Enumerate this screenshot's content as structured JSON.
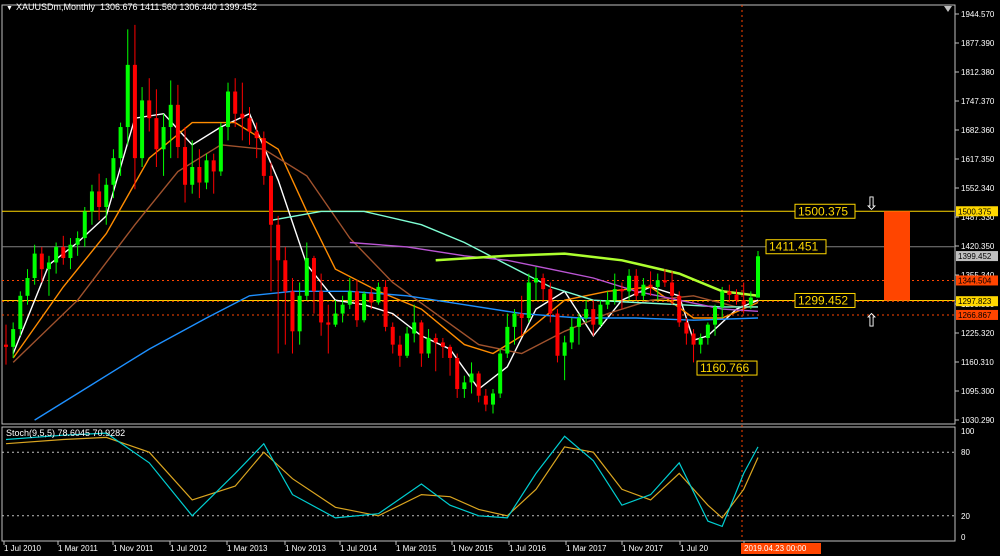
{
  "header": {
    "symbol": "XAUUSDm,Monthly",
    "ohlc": "1306.676 1411.560 1306.440 1399.452"
  },
  "stochastic": {
    "label": "Stoch(9,5,5) 78.6045 70.9282",
    "levels": [
      80,
      20
    ],
    "scale_labels": [
      "100",
      "80",
      "20",
      "0"
    ]
  },
  "colors": {
    "background": "#000000",
    "bull": "#00ff00",
    "bear": "#ff0000",
    "hline": "#ffd700",
    "box": "#ff4500",
    "ma_white": "#ffffff",
    "ma_orange": "#ff8c00",
    "ma_sienna": "#a0522d",
    "ma_aqua": "#7fffd4",
    "ma_violet": "#ba55d3",
    "ma_blue": "#1e90ff",
    "ma_yellowgreen": "#adff2f",
    "stoch_main": "#00ced1",
    "stoch_signal": "#daa520"
  },
  "chart_data": {
    "type": "candlestick",
    "title": "XAUUSDm,Monthly",
    "price_axis_labels": [
      "1944.570",
      "1877.390",
      "1812.380",
      "1747.370",
      "1682.360",
      "1617.350",
      "1552.340",
      "1487.330",
      "1420.350",
      "1355.340",
      "1290.330",
      "1225.320",
      "1160.310",
      "1095.300",
      "1030.290"
    ],
    "ylim": [
      1030.29,
      1944.57
    ],
    "time_axis_labels": [
      "1 Jul 2010",
      "1 Mar 2011",
      "1 Nov 2011",
      "1 Jul 2012",
      "1 Mar 2013",
      "1 Nov 2013",
      "1 Jul 2014",
      "1 Mar 2015",
      "1 Nov 2015",
      "1 Jul 2016",
      "1 Mar 2017",
      "1 Nov 2017",
      "1 Jul 20",
      "2019.04.23 00:00"
    ],
    "horizontal_lines": [
      {
        "label": "1500.375",
        "price": 1500.375,
        "style": "solid"
      },
      {
        "label": "1411.451",
        "price": 1420.35,
        "style": "solid-gray"
      },
      {
        "label": "1299.452",
        "price": 1299.452,
        "style": "solid"
      },
      {
        "label": "1344.504",
        "price": 1344.504,
        "style": "dotted"
      },
      {
        "label": "1297.823",
        "price": 1297.823,
        "style": "dotted"
      },
      {
        "label": "1266.867",
        "price": 1266.867,
        "style": "dotted"
      }
    ],
    "annotations": [
      {
        "text": "1500.375"
      },
      {
        "text": "1411.451"
      },
      {
        "text": "1299.452"
      },
      {
        "text": "1160.766"
      }
    ],
    "price_tags": [
      {
        "text": "1500.375",
        "price": 1500.375,
        "bg": "#ffd700",
        "fg": "#000000"
      },
      {
        "text": "1399.452",
        "price": 1399.452,
        "bg": "#c0c0c0",
        "fg": "#000000"
      },
      {
        "text": "1344.504",
        "price": 1344.504,
        "bg": "#ff4500",
        "fg": "#000000"
      },
      {
        "text": "1297.823",
        "price": 1297.823,
        "bg": "#ffd700",
        "fg": "#000000"
      },
      {
        "text": "1266.867",
        "price": 1266.867,
        "bg": "#ff4500",
        "fg": "#000000"
      }
    ],
    "candles": [
      [
        1200,
        1245,
        1155,
        1195
      ],
      [
        1195,
        1250,
        1170,
        1235
      ],
      [
        1235,
        1320,
        1220,
        1310
      ],
      [
        1310,
        1370,
        1290,
        1350
      ],
      [
        1350,
        1425,
        1335,
        1405
      ],
      [
        1405,
        1420,
        1340,
        1370
      ],
      [
        1370,
        1400,
        1310,
        1385
      ],
      [
        1385,
        1430,
        1360,
        1420
      ],
      [
        1420,
        1445,
        1380,
        1395
      ],
      [
        1395,
        1440,
        1370,
        1425
      ],
      [
        1425,
        1455,
        1400,
        1440
      ],
      [
        1440,
        1510,
        1420,
        1500
      ],
      [
        1500,
        1560,
        1470,
        1545
      ],
      [
        1545,
        1585,
        1480,
        1510
      ],
      [
        1510,
        1575,
        1470,
        1560
      ],
      [
        1560,
        1640,
        1530,
        1620
      ],
      [
        1620,
        1700,
        1580,
        1690
      ],
      [
        1690,
        1910,
        1650,
        1830
      ],
      [
        1830,
        1920,
        1550,
        1620
      ],
      [
        1620,
        1780,
        1600,
        1750
      ],
      [
        1750,
        1800,
        1680,
        1710
      ],
      [
        1710,
        1775,
        1600,
        1640
      ],
      [
        1640,
        1720,
        1580,
        1690
      ],
      [
        1690,
        1795,
        1620,
        1740
      ],
      [
        1740,
        1785,
        1620,
        1645
      ],
      [
        1645,
        1690,
        1520,
        1560
      ],
      [
        1560,
        1660,
        1540,
        1600
      ],
      [
        1600,
        1640,
        1530,
        1565
      ],
      [
        1565,
        1630,
        1550,
        1615
      ],
      [
        1615,
        1630,
        1540,
        1590
      ],
      [
        1590,
        1700,
        1580,
        1690
      ],
      [
        1690,
        1790,
        1660,
        1770
      ],
      [
        1770,
        1800,
        1690,
        1720
      ],
      [
        1720,
        1790,
        1660,
        1710
      ],
      [
        1710,
        1735,
        1650,
        1680
      ],
      [
        1680,
        1700,
        1620,
        1665
      ],
      [
        1665,
        1680,
        1560,
        1580
      ],
      [
        1580,
        1610,
        1320,
        1470
      ],
      [
        1470,
        1490,
        1180,
        1390
      ],
      [
        1390,
        1420,
        1200,
        1320
      ],
      [
        1320,
        1350,
        1180,
        1230
      ],
      [
        1230,
        1340,
        1200,
        1310
      ],
      [
        1310,
        1430,
        1300,
        1395
      ],
      [
        1395,
        1400,
        1270,
        1320
      ],
      [
        1320,
        1360,
        1220,
        1250
      ],
      [
        1250,
        1290,
        1180,
        1245
      ],
      [
        1245,
        1300,
        1240,
        1270
      ],
      [
        1270,
        1310,
        1250,
        1290
      ],
      [
        1290,
        1350,
        1280,
        1320
      ],
      [
        1320,
        1345,
        1240,
        1255
      ],
      [
        1255,
        1320,
        1250,
        1315
      ],
      [
        1315,
        1330,
        1280,
        1295
      ],
      [
        1295,
        1340,
        1290,
        1330
      ],
      [
        1330,
        1345,
        1230,
        1240
      ],
      [
        1240,
        1250,
        1180,
        1200
      ],
      [
        1200,
        1220,
        1150,
        1175
      ],
      [
        1175,
        1240,
        1170,
        1225
      ],
      [
        1225,
        1290,
        1205,
        1250
      ],
      [
        1250,
        1255,
        1150,
        1180
      ],
      [
        1180,
        1235,
        1170,
        1215
      ],
      [
        1215,
        1225,
        1140,
        1205
      ],
      [
        1205,
        1215,
        1170,
        1195
      ],
      [
        1195,
        1200,
        1130,
        1170
      ],
      [
        1170,
        1180,
        1080,
        1100
      ],
      [
        1100,
        1130,
        1080,
        1115
      ],
      [
        1115,
        1160,
        1090,
        1135
      ],
      [
        1135,
        1140,
        1070,
        1085
      ],
      [
        1085,
        1100,
        1050,
        1065
      ],
      [
        1065,
        1100,
        1045,
        1090
      ],
      [
        1090,
        1190,
        1080,
        1180
      ],
      [
        1180,
        1270,
        1170,
        1240
      ],
      [
        1240,
        1280,
        1200,
        1270
      ],
      [
        1270,
        1310,
        1220,
        1260
      ],
      [
        1260,
        1360,
        1250,
        1340
      ],
      [
        1340,
        1375,
        1300,
        1350
      ],
      [
        1350,
        1360,
        1300,
        1325
      ],
      [
        1325,
        1340,
        1250,
        1270
      ],
      [
        1270,
        1280,
        1160,
        1175
      ],
      [
        1175,
        1220,
        1120,
        1205
      ],
      [
        1205,
        1260,
        1190,
        1240
      ],
      [
        1240,
        1270,
        1200,
        1260
      ],
      [
        1260,
        1300,
        1250,
        1280
      ],
      [
        1280,
        1300,
        1220,
        1245
      ],
      [
        1245,
        1300,
        1240,
        1290
      ],
      [
        1290,
        1320,
        1280,
        1300
      ],
      [
        1300,
        1360,
        1290,
        1325
      ],
      [
        1325,
        1340,
        1280,
        1320
      ],
      [
        1320,
        1370,
        1300,
        1355
      ],
      [
        1355,
        1370,
        1300,
        1310
      ],
      [
        1310,
        1350,
        1300,
        1335
      ],
      [
        1335,
        1365,
        1310,
        1330
      ],
      [
        1330,
        1360,
        1300,
        1345
      ],
      [
        1345,
        1370,
        1330,
        1340
      ],
      [
        1340,
        1365,
        1290,
        1310
      ],
      [
        1310,
        1320,
        1240,
        1250
      ],
      [
        1250,
        1260,
        1200,
        1225
      ],
      [
        1225,
        1235,
        1160,
        1200
      ],
      [
        1200,
        1225,
        1180,
        1215
      ],
      [
        1215,
        1250,
        1200,
        1245
      ],
      [
        1245,
        1290,
        1220,
        1285
      ],
      [
        1285,
        1330,
        1260,
        1320
      ],
      [
        1320,
        1335,
        1295,
        1312
      ],
      [
        1312,
        1325,
        1290,
        1300
      ],
      [
        1300,
        1340,
        1270,
        1290
      ],
      [
        1290,
        1320,
        1280,
        1306
      ],
      [
        1306,
        1411,
        1306,
        1399
      ]
    ],
    "moving_averages": [
      {
        "color": "#ffffff",
        "points": [
          [
            1,
            1180
          ],
          [
            6,
            1380
          ],
          [
            10,
            1430
          ],
          [
            14,
            1490
          ],
          [
            18,
            1710
          ],
          [
            22,
            1720
          ],
          [
            26,
            1650
          ],
          [
            30,
            1690
          ],
          [
            34,
            1720
          ],
          [
            38,
            1570
          ],
          [
            42,
            1380
          ],
          [
            46,
            1300
          ],
          [
            50,
            1290
          ],
          [
            54,
            1270
          ],
          [
            58,
            1220
          ],
          [
            62,
            1190
          ],
          [
            66,
            1100
          ],
          [
            70,
            1150
          ],
          [
            74,
            1280
          ],
          [
            78,
            1320
          ],
          [
            82,
            1220
          ],
          [
            86,
            1300
          ],
          [
            90,
            1330
          ],
          [
            94,
            1310
          ],
          [
            96,
            1210
          ],
          [
            98,
            1220
          ],
          [
            102,
            1280
          ],
          [
            105,
            1300
          ]
        ]
      },
      {
        "color": "#ff8c00",
        "points": [
          [
            1,
            1170
          ],
          [
            8,
            1330
          ],
          [
            14,
            1450
          ],
          [
            20,
            1620
          ],
          [
            26,
            1700
          ],
          [
            32,
            1700
          ],
          [
            38,
            1640
          ],
          [
            42,
            1500
          ],
          [
            46,
            1370
          ],
          [
            52,
            1320
          ],
          [
            58,
            1280
          ],
          [
            64,
            1200
          ],
          [
            68,
            1180
          ],
          [
            72,
            1220
          ],
          [
            78,
            1300
          ],
          [
            84,
            1320
          ],
          [
            90,
            1330
          ],
          [
            96,
            1260
          ],
          [
            100,
            1260
          ],
          [
            105,
            1295
          ]
        ]
      },
      {
        "color": "#a0522d",
        "points": [
          [
            1,
            1160
          ],
          [
            10,
            1300
          ],
          [
            18,
            1470
          ],
          [
            24,
            1590
          ],
          [
            30,
            1650
          ],
          [
            36,
            1640
          ],
          [
            42,
            1580
          ],
          [
            48,
            1440
          ],
          [
            54,
            1340
          ],
          [
            60,
            1270
          ],
          [
            66,
            1200
          ],
          [
            72,
            1180
          ],
          [
            78,
            1230
          ],
          [
            84,
            1270
          ],
          [
            90,
            1300
          ],
          [
            96,
            1310
          ],
          [
            102,
            1285
          ],
          [
            105,
            1285
          ]
        ]
      },
      {
        "color": "#7fffd4",
        "points": [
          [
            37,
            1480
          ],
          [
            44,
            1500
          ],
          [
            50,
            1500
          ],
          [
            58,
            1470
          ],
          [
            64,
            1430
          ],
          [
            70,
            1380
          ],
          [
            76,
            1330
          ],
          [
            82,
            1300
          ],
          [
            88,
            1295
          ],
          [
            94,
            1290
          ],
          [
            100,
            1285
          ],
          [
            105,
            1285
          ]
        ]
      },
      {
        "color": "#ba55d3",
        "points": [
          [
            48,
            1430
          ],
          [
            56,
            1420
          ],
          [
            64,
            1400
          ],
          [
            70,
            1390
          ],
          [
            76,
            1370
          ],
          [
            82,
            1350
          ],
          [
            88,
            1320
          ],
          [
            94,
            1300
          ],
          [
            100,
            1280
          ],
          [
            105,
            1275
          ]
        ]
      },
      {
        "color": "#1e90ff",
        "points": [
          [
            4,
            1030
          ],
          [
            12,
            1110
          ],
          [
            20,
            1190
          ],
          [
            28,
            1260
          ],
          [
            34,
            1310
          ],
          [
            40,
            1320
          ],
          [
            48,
            1320
          ],
          [
            56,
            1310
          ],
          [
            64,
            1290
          ],
          [
            72,
            1270
          ],
          [
            80,
            1260
          ],
          [
            88,
            1260
          ],
          [
            96,
            1255
          ],
          [
            105,
            1260
          ]
        ]
      },
      {
        "color": "#adff2f",
        "points": [
          [
            60,
            1390
          ],
          [
            70,
            1400
          ],
          [
            78,
            1405
          ],
          [
            86,
            1390
          ],
          [
            94,
            1360
          ],
          [
            100,
            1320
          ],
          [
            105,
            1310
          ]
        ]
      }
    ],
    "stochastic": {
      "main": [
        [
          0,
          92
        ],
        [
          8,
          96
        ],
        [
          14,
          98
        ],
        [
          20,
          70
        ],
        [
          26,
          20
        ],
        [
          32,
          60
        ],
        [
          36,
          88
        ],
        [
          40,
          40
        ],
        [
          46,
          18
        ],
        [
          52,
          22
        ],
        [
          58,
          50
        ],
        [
          62,
          30
        ],
        [
          66,
          20
        ],
        [
          70,
          18
        ],
        [
          74,
          60
        ],
        [
          78,
          95
        ],
        [
          82,
          72
        ],
        [
          86,
          30
        ],
        [
          90,
          40
        ],
        [
          94,
          70
        ],
        [
          98,
          15
        ],
        [
          100,
          10
        ],
        [
          103,
          60
        ],
        [
          105,
          85
        ]
      ],
      "signal": [
        [
          0,
          88
        ],
        [
          8,
          92
        ],
        [
          14,
          94
        ],
        [
          20,
          80
        ],
        [
          26,
          35
        ],
        [
          32,
          48
        ],
        [
          36,
          80
        ],
        [
          40,
          55
        ],
        [
          46,
          28
        ],
        [
          52,
          20
        ],
        [
          58,
          40
        ],
        [
          62,
          38
        ],
        [
          66,
          26
        ],
        [
          70,
          20
        ],
        [
          74,
          45
        ],
        [
          78,
          85
        ],
        [
          82,
          80
        ],
        [
          86,
          45
        ],
        [
          90,
          35
        ],
        [
          94,
          60
        ],
        [
          98,
          30
        ],
        [
          100,
          18
        ],
        [
          103,
          45
        ],
        [
          105,
          75
        ]
      ]
    }
  }
}
